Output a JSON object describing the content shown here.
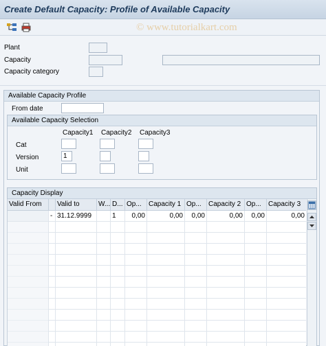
{
  "window": {
    "title": "Create Default Capacity: Profile of Available Capacity"
  },
  "toolbar": {
    "icons": [
      "hierarchy-icon",
      "printer-icon"
    ]
  },
  "watermark": "© www.tutorialkart.com",
  "header_fields": {
    "plant_label": "Plant",
    "capacity_label": "Capacity",
    "capacity_category_label": "Capacity category"
  },
  "profile": {
    "group_title": "Available Capacity Profile",
    "from_date_label": "From date",
    "selection": {
      "group_title": "Available Capacity Selection",
      "columns": [
        "Capacity1",
        "Capacity2",
        "Capacity3"
      ],
      "row_labels": [
        "Cat",
        "Version",
        "Unit"
      ],
      "version_value": "1"
    }
  },
  "capacity_display": {
    "group_title": "Capacity Display",
    "headers": [
      "Valid From",
      "Valid to",
      "W...",
      "D...",
      "Op...",
      "Capacity 1",
      "Op...",
      "Capacity 2",
      "Op...",
      "Capacity 3"
    ],
    "rows": [
      [
        "",
        "-",
        "31.12.9999",
        "",
        "1",
        "0,00",
        "0,00",
        "0,00",
        "0,00",
        "0,00",
        "0,00"
      ]
    ]
  },
  "colors": {
    "title_text": "#1d3a5b",
    "watermark": "#e6cfa8"
  }
}
